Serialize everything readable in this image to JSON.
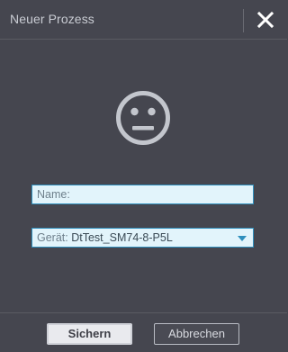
{
  "dialog": {
    "title": "Neuer Prozess",
    "close_icon": "close-icon",
    "status_icon": "neutral-face-icon"
  },
  "form": {
    "name_placeholder": "Name:",
    "device_label": "Gerät:",
    "device_value": "DtTest_SM74-8-P5L"
  },
  "buttons": {
    "save_label": "Sichern",
    "cancel_label": "Abbrechen"
  },
  "colors": {
    "background": "#45464f",
    "accent": "#2f8fbd",
    "field_bg": "#e2f4fb"
  }
}
